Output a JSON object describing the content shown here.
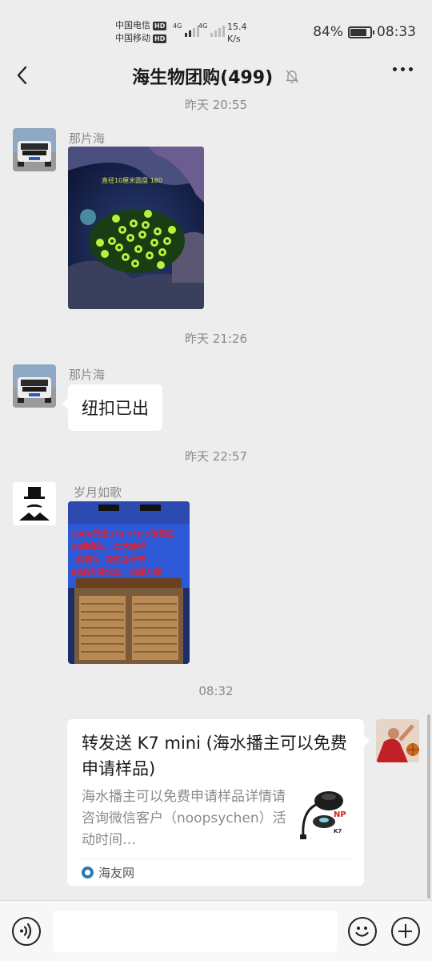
{
  "status_bar": {
    "carrier1": "中国电信",
    "carrier2": "中国移动",
    "hd": "HD",
    "net1": "4G",
    "net2": "4G",
    "speed_value": "15.4",
    "speed_unit": "K/s",
    "battery_percent": "84%",
    "battery_level": 0.84,
    "time": "08:33"
  },
  "nav": {
    "title": "海生物团购(499)",
    "back_icon": "chevron-left-icon",
    "mute_icon": "bell-off-icon",
    "more_icon": "more-dots-icon"
  },
  "messages": [
    {
      "type": "time",
      "text": "昨天 20:55"
    },
    {
      "type": "image",
      "sender": "那片海",
      "avatar": "car-avatar",
      "image_caption": "直径10厘米圆盘 180"
    },
    {
      "type": "time",
      "text": "昨天 21:26"
    },
    {
      "type": "text",
      "sender": "那片海",
      "avatar": "car-avatar",
      "text": "纽扣已出"
    },
    {
      "type": "time",
      "text": "昨天 22:57"
    },
    {
      "type": "image",
      "sender": "岁月如歌",
      "avatar": "gentleman-avatar",
      "image_lines": [
        "1000元出1*0.7*0.5米超白",
        "10厘鱼缸，实木底柜",
        "底滤8，鱼缸总计带",
        "90的升降水缸，自提方便"
      ]
    },
    {
      "type": "time",
      "text": "08:32"
    },
    {
      "type": "link_card",
      "self": true,
      "avatar": "basketball-avatar",
      "title": "转发送 K7 mini (海水播主可以免费申请样品)",
      "description": "海水播主可以免费申请样品详情请咨询微信客户（noopsychen）活动时间…",
      "thumb_brand": "NP",
      "thumb_model": "K7",
      "source": "海友网"
    }
  ],
  "input_bar": {
    "voice_icon": "voice-icon",
    "emoji_icon": "emoji-icon",
    "plus_icon": "plus-icon",
    "placeholder": ""
  }
}
